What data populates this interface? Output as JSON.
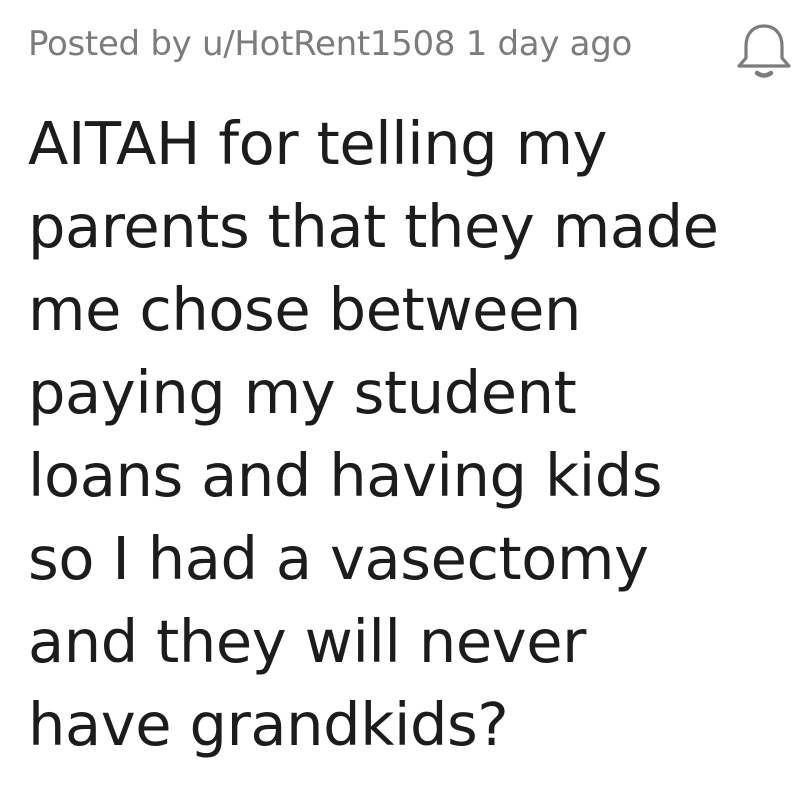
{
  "post": {
    "meta": "Posted by u/HotRent1508 1 day ago",
    "notification_icon": "bell-icon",
    "title_lines": [
      "AITAH for telling my",
      "parents that they made",
      "me chose between",
      "paying my student",
      "loans and having kids",
      "so I had a vasectomy",
      "and they will never",
      "have grandkids?"
    ]
  },
  "colors": {
    "meta_text": "#7c7c7c",
    "title_text": "#1c1c1c",
    "icon_stroke": "#7c7c7c",
    "background": "#ffffff"
  }
}
